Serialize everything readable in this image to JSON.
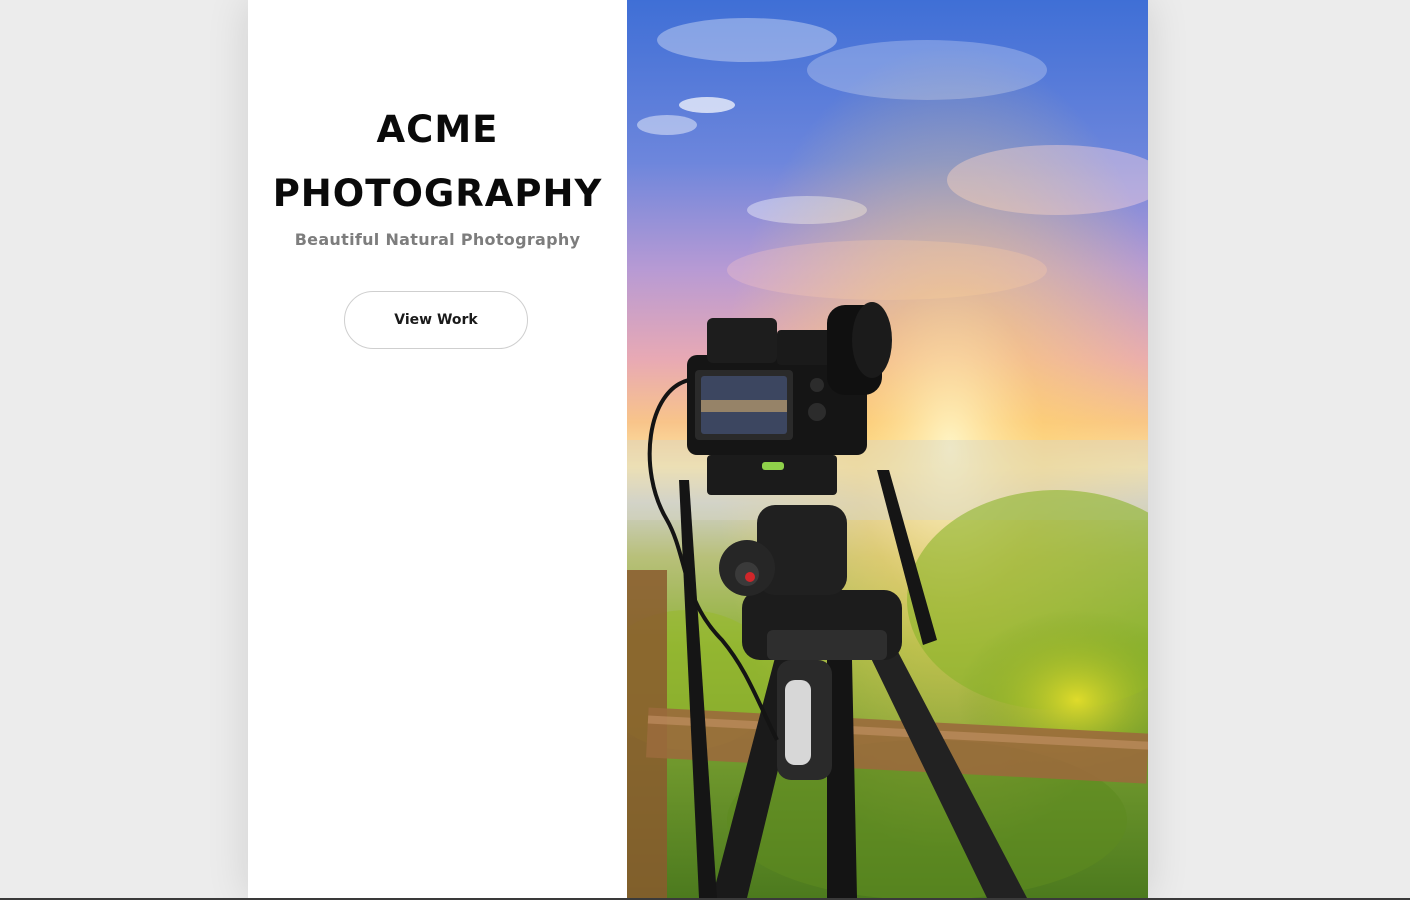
{
  "brand": {
    "title_line1": "ACME",
    "title_line2": "PHOTOGRAPHY",
    "tagline": "Beautiful Natural Photography"
  },
  "cta": {
    "label": "View Work"
  },
  "hero": {
    "subject": "camera-on-tripod-at-sunset"
  },
  "colors": {
    "background": "#ececec",
    "panel": "#ffffff",
    "title": "#0a0a0a",
    "tagline": "#7d7d7d"
  }
}
